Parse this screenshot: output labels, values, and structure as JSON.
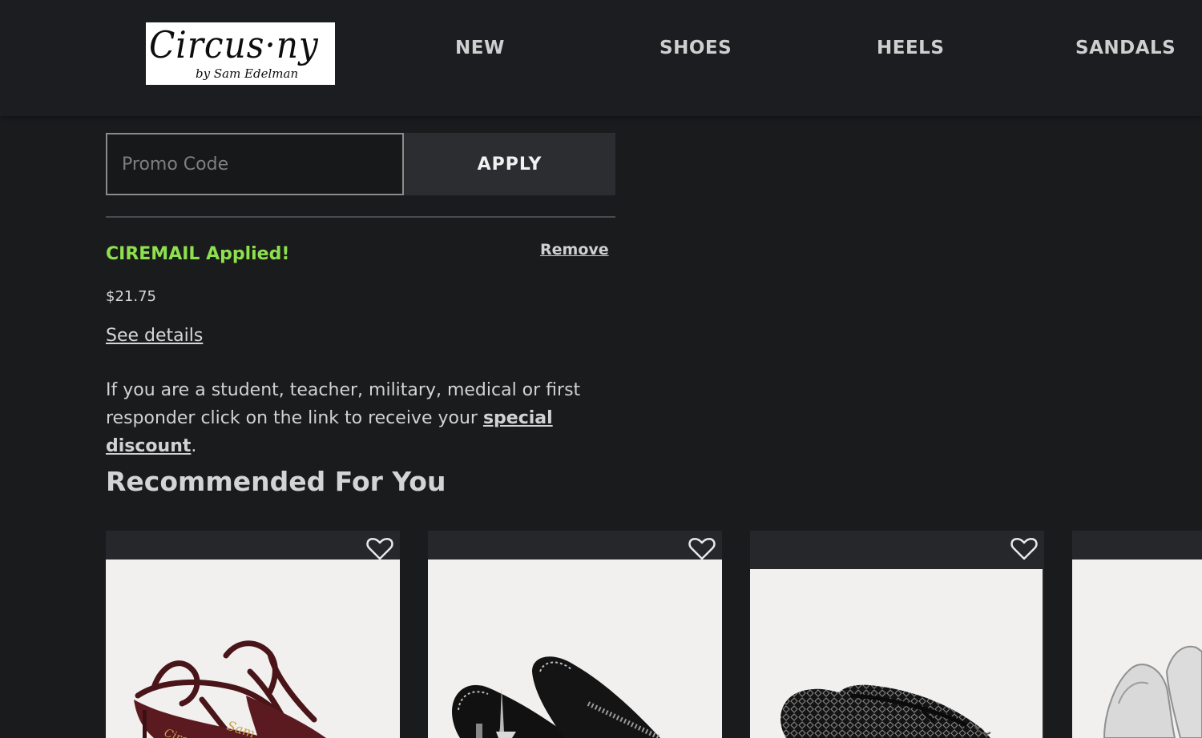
{
  "header": {
    "logo": {
      "text": "Circus·ny",
      "subtext": "by Sam Edelman"
    },
    "nav": [
      {
        "label": "NEW"
      },
      {
        "label": "SHOES"
      },
      {
        "label": "HEELS"
      },
      {
        "label": "SANDALS"
      }
    ]
  },
  "promo": {
    "placeholder": "Promo Code",
    "value": "",
    "apply_label": "APPLY",
    "applied_message": "CIREMAIL Applied!",
    "remove_label": "Remove",
    "discount_amount": "$21.75",
    "see_details_label": "See details",
    "discount_text_before": "If you are a student, teacher, military, medical or first responder click on the link to receive your ",
    "discount_link_label": "special discount",
    "discount_text_after": ".",
    "applied_color": "#8ee04e"
  },
  "recommended": {
    "title": "Recommended For You",
    "products": [
      {
        "image_icon": "burgundy-strappy-kitten-heel-sandal",
        "wishlist_icon": "heart-outline-icon"
      },
      {
        "image_icon": "black-embellished-heeled-mule",
        "wishlist_icon": "heart-outline-icon"
      },
      {
        "image_icon": "black-mesh-ballet-flat",
        "wishlist_icon": "heart-outline-icon"
      },
      {
        "image_icon": "white-pointed-flat",
        "wishlist_icon": "heart-outline-icon"
      }
    ]
  },
  "colors": {
    "background": "#1a1b1d",
    "header": "#1c1d20",
    "button": "#2b2d31",
    "text": "#d6d6d6"
  }
}
